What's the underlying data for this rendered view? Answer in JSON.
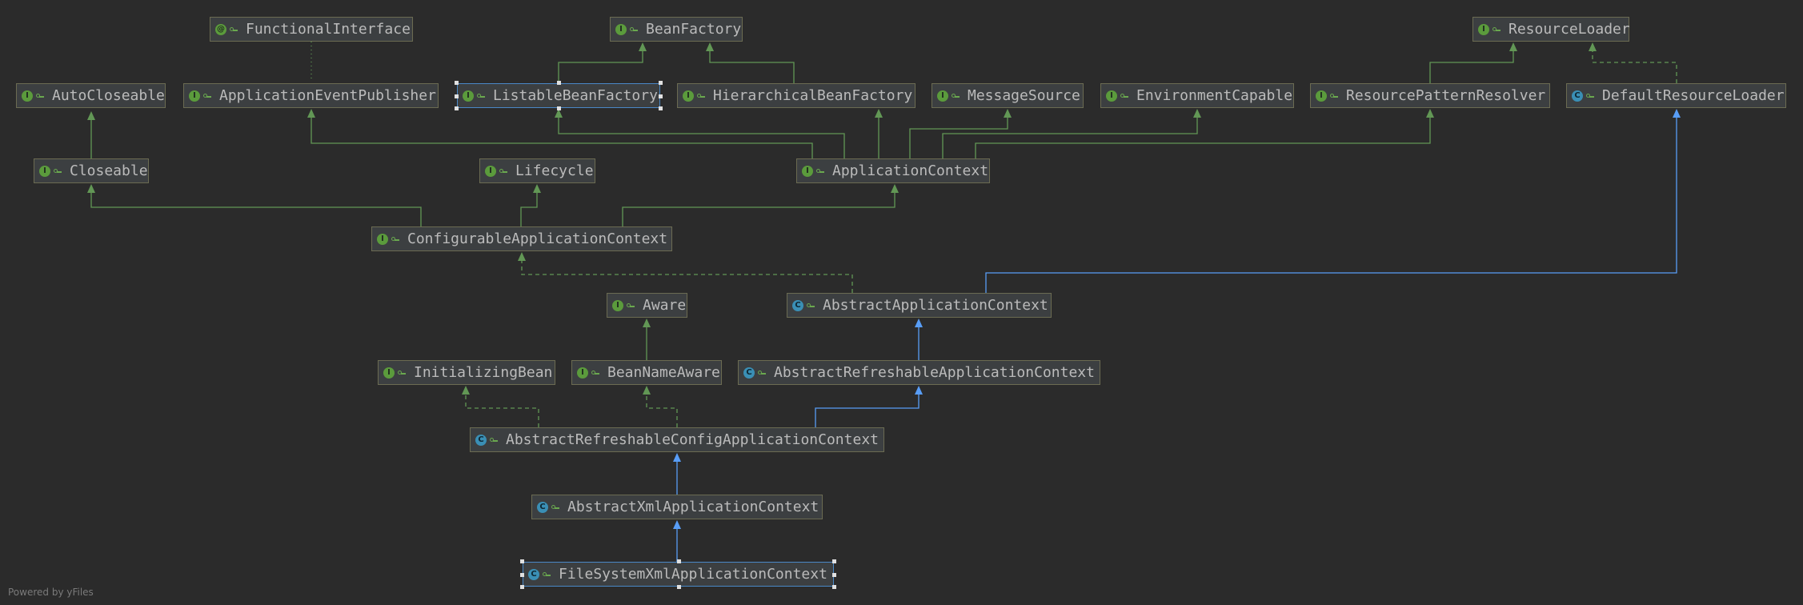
{
  "footer": "Powered by yFiles",
  "colors": {
    "background": "#2b2b2b",
    "interface_edge": "#629755",
    "class_edge": "#589df6",
    "selection": "#4a88c7"
  },
  "nodes": [
    {
      "id": "functional-interface",
      "label": "FunctionalInterface",
      "kind": "functional"
    },
    {
      "id": "bean-factory",
      "label": "BeanFactory",
      "kind": "interface"
    },
    {
      "id": "resource-loader",
      "label": "ResourceLoader",
      "kind": "interface"
    },
    {
      "id": "auto-closeable",
      "label": "AutoCloseable",
      "kind": "interface"
    },
    {
      "id": "application-event-publisher",
      "label": "ApplicationEventPublisher",
      "kind": "interface"
    },
    {
      "id": "listable-bean-factory",
      "label": "ListableBeanFactory",
      "kind": "interface",
      "selected": true
    },
    {
      "id": "hierarchical-bean-factory",
      "label": "HierarchicalBeanFactory",
      "kind": "interface"
    },
    {
      "id": "message-source",
      "label": "MessageSource",
      "kind": "interface"
    },
    {
      "id": "environment-capable",
      "label": "EnvironmentCapable",
      "kind": "interface"
    },
    {
      "id": "resource-pattern-resolver",
      "label": "ResourcePatternResolver",
      "kind": "interface"
    },
    {
      "id": "default-resource-loader",
      "label": "DefaultResourceLoader",
      "kind": "class"
    },
    {
      "id": "closeable",
      "label": "Closeable",
      "kind": "interface"
    },
    {
      "id": "lifecycle",
      "label": "Lifecycle",
      "kind": "interface"
    },
    {
      "id": "application-context",
      "label": "ApplicationContext",
      "kind": "interface"
    },
    {
      "id": "configurable-application-context",
      "label": "ConfigurableApplicationContext",
      "kind": "interface"
    },
    {
      "id": "aware",
      "label": "Aware",
      "kind": "interface"
    },
    {
      "id": "abstract-application-context",
      "label": "AbstractApplicationContext",
      "kind": "abstract-class"
    },
    {
      "id": "initializing-bean",
      "label": "InitializingBean",
      "kind": "interface"
    },
    {
      "id": "bean-name-aware",
      "label": "BeanNameAware",
      "kind": "interface"
    },
    {
      "id": "abstract-refreshable-application-context",
      "label": "AbstractRefreshableApplicationContext",
      "kind": "abstract-class"
    },
    {
      "id": "abstract-refreshable-config-application-context",
      "label": "AbstractRefreshableConfigApplicationContext",
      "kind": "abstract-class"
    },
    {
      "id": "abstract-xml-application-context",
      "label": "AbstractXmlApplicationContext",
      "kind": "abstract-class"
    },
    {
      "id": "file-system-xml-application-context",
      "label": "FileSystemXmlApplicationContext",
      "kind": "class",
      "selected": true
    }
  ],
  "edges": [
    {
      "from": "functional-interface",
      "to": "application-event-publisher",
      "type": "annotation"
    },
    {
      "from": "listable-bean-factory",
      "to": "bean-factory",
      "type": "extends"
    },
    {
      "from": "hierarchical-bean-factory",
      "to": "bean-factory",
      "type": "extends"
    },
    {
      "from": "resource-pattern-resolver",
      "to": "resource-loader",
      "type": "extends"
    },
    {
      "from": "default-resource-loader",
      "to": "resource-loader",
      "type": "implements"
    },
    {
      "from": "closeable",
      "to": "auto-closeable",
      "type": "extends"
    },
    {
      "from": "application-context",
      "to": "application-event-publisher",
      "type": "extends"
    },
    {
      "from": "application-context",
      "to": "listable-bean-factory",
      "type": "extends"
    },
    {
      "from": "application-context",
      "to": "hierarchical-bean-factory",
      "type": "extends"
    },
    {
      "from": "application-context",
      "to": "message-source",
      "type": "extends"
    },
    {
      "from": "application-context",
      "to": "environment-capable",
      "type": "extends"
    },
    {
      "from": "application-context",
      "to": "resource-pattern-resolver",
      "type": "extends"
    },
    {
      "from": "configurable-application-context",
      "to": "closeable",
      "type": "extends"
    },
    {
      "from": "configurable-application-context",
      "to": "lifecycle",
      "type": "extends"
    },
    {
      "from": "configurable-application-context",
      "to": "application-context",
      "type": "extends"
    },
    {
      "from": "abstract-application-context",
      "to": "configurable-application-context",
      "type": "implements"
    },
    {
      "from": "abstract-application-context",
      "to": "default-resource-loader",
      "type": "class-extends"
    },
    {
      "from": "bean-name-aware",
      "to": "aware",
      "type": "extends"
    },
    {
      "from": "abstract-refreshable-application-context",
      "to": "abstract-application-context",
      "type": "class-extends"
    },
    {
      "from": "abstract-refreshable-config-application-context",
      "to": "initializing-bean",
      "type": "implements"
    },
    {
      "from": "abstract-refreshable-config-application-context",
      "to": "bean-name-aware",
      "type": "implements"
    },
    {
      "from": "abstract-refreshable-config-application-context",
      "to": "abstract-refreshable-application-context",
      "type": "class-extends"
    },
    {
      "from": "abstract-xml-application-context",
      "to": "abstract-refreshable-config-application-context",
      "type": "class-extends"
    },
    {
      "from": "file-system-xml-application-context",
      "to": "abstract-xml-application-context",
      "type": "class-extends"
    }
  ]
}
